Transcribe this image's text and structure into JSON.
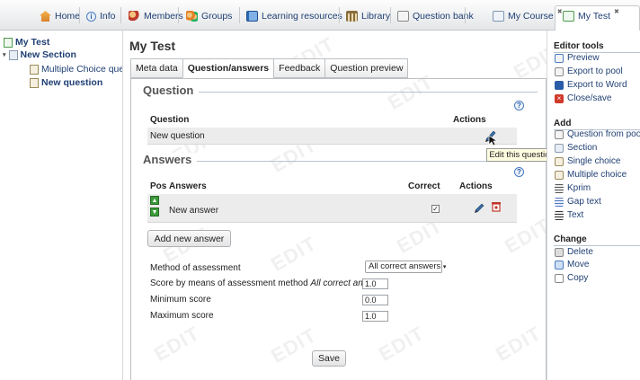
{
  "top_tabs": [
    {
      "label": "Home",
      "icon": "home-icon"
    },
    {
      "label": "Info",
      "icon": "info-icon"
    },
    {
      "label": "Members",
      "icon": "members-icon"
    },
    {
      "label": "Groups",
      "icon": "groups-icon"
    },
    {
      "label": "Learning resources",
      "icon": "book-icon"
    },
    {
      "label": "Library",
      "icon": "library-icon"
    },
    {
      "label": "Question bank",
      "icon": "question-bank-icon"
    },
    {
      "label": "My Course",
      "icon": "course-icon",
      "closable": true
    },
    {
      "label": "My Test",
      "icon": "test-icon",
      "closable": true,
      "active": true
    }
  ],
  "tree": {
    "root": "My Test",
    "section": "New Section",
    "items": [
      "Multiple Choice quest",
      "New question"
    ]
  },
  "page_title": "My Test",
  "sub_tabs": [
    {
      "label": "Meta data"
    },
    {
      "label": "Question/answers",
      "active": true
    },
    {
      "label": "Feedback"
    },
    {
      "label": "Question preview"
    }
  ],
  "question_section": {
    "legend": "Question",
    "col_question": "Question",
    "col_actions": "Actions",
    "rows": [
      {
        "text": "New question"
      }
    ]
  },
  "tooltip": "Edit this question",
  "answers_section": {
    "legend": "Answers",
    "col_pos": "Pos",
    "col_answers": "Answers",
    "col_correct": "Correct",
    "col_actions": "Actions",
    "rows": [
      {
        "text": "New answer",
        "correct": true
      }
    ],
    "add_button": "Add new answer"
  },
  "assessment": {
    "method_label": "Method of assessment",
    "method_value": "All correct answers",
    "score_label_prefix": "Score by means of assessment method ",
    "score_label_method": "All correct answers",
    "score_value": "1.0",
    "min_label": "Minimum score",
    "min_value": "0.0",
    "max_label": "Maximum score",
    "max_value": "1.0"
  },
  "save_button": "Save",
  "right_panel": {
    "editor_tools": {
      "header": "Editor tools",
      "items": [
        "Preview",
        "Export to pool",
        "Export to Word",
        "Close/save"
      ]
    },
    "add": {
      "header": "Add",
      "items": [
        "Question from pool",
        "Section",
        "Single choice",
        "Multiple choice",
        "Kprim",
        "Gap text",
        "Text"
      ]
    },
    "change": {
      "header": "Change",
      "items": [
        "Delete",
        "Move",
        "Copy"
      ]
    }
  },
  "watermark": "EDIT",
  "colors": {
    "link": "#1f3f73",
    "accent": "#4a7cc0",
    "close_icon": "#d03a2a"
  }
}
